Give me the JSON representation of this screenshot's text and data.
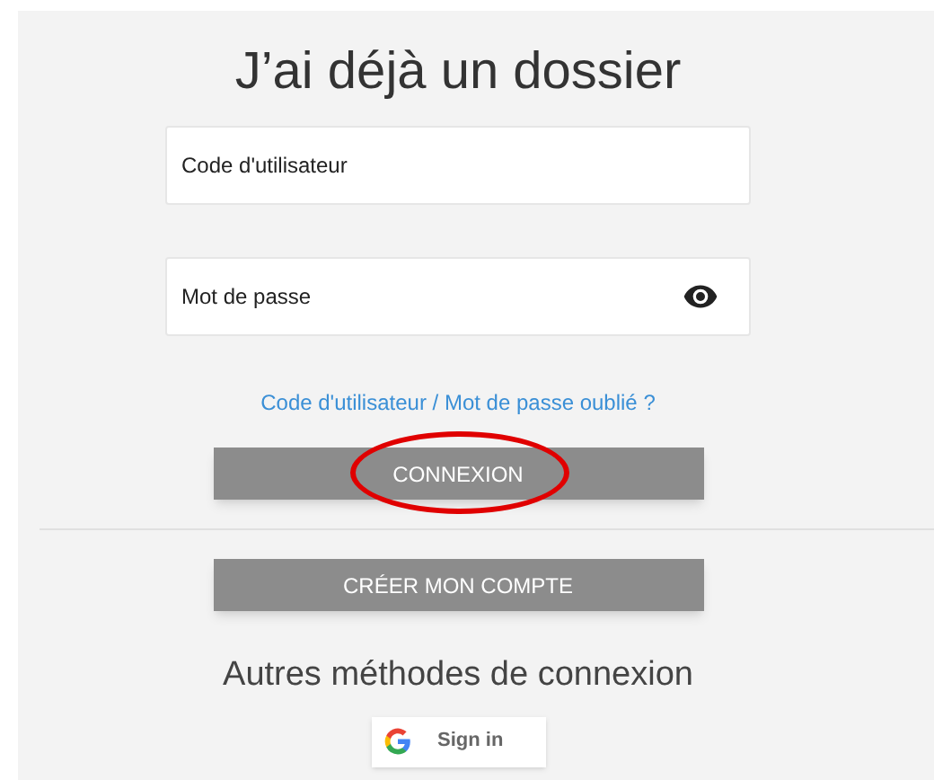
{
  "title": "J’ai déjà un dossier",
  "fields": [
    {
      "placeholder": "Code d'utilisateur",
      "kind": "text"
    },
    {
      "placeholder": "Mot de passe",
      "kind": "password"
    }
  ],
  "forgot_link": "Code d'utilisateur / Mot de passe oublié ?",
  "buttons": [
    {
      "label": "CONNEXION",
      "circled": true
    },
    {
      "label": "CRÉER MON COMPTE",
      "circled": false
    }
  ],
  "other_methods": {
    "heading": "Autres méthodes de connexion",
    "google_button": "Sign in"
  }
}
